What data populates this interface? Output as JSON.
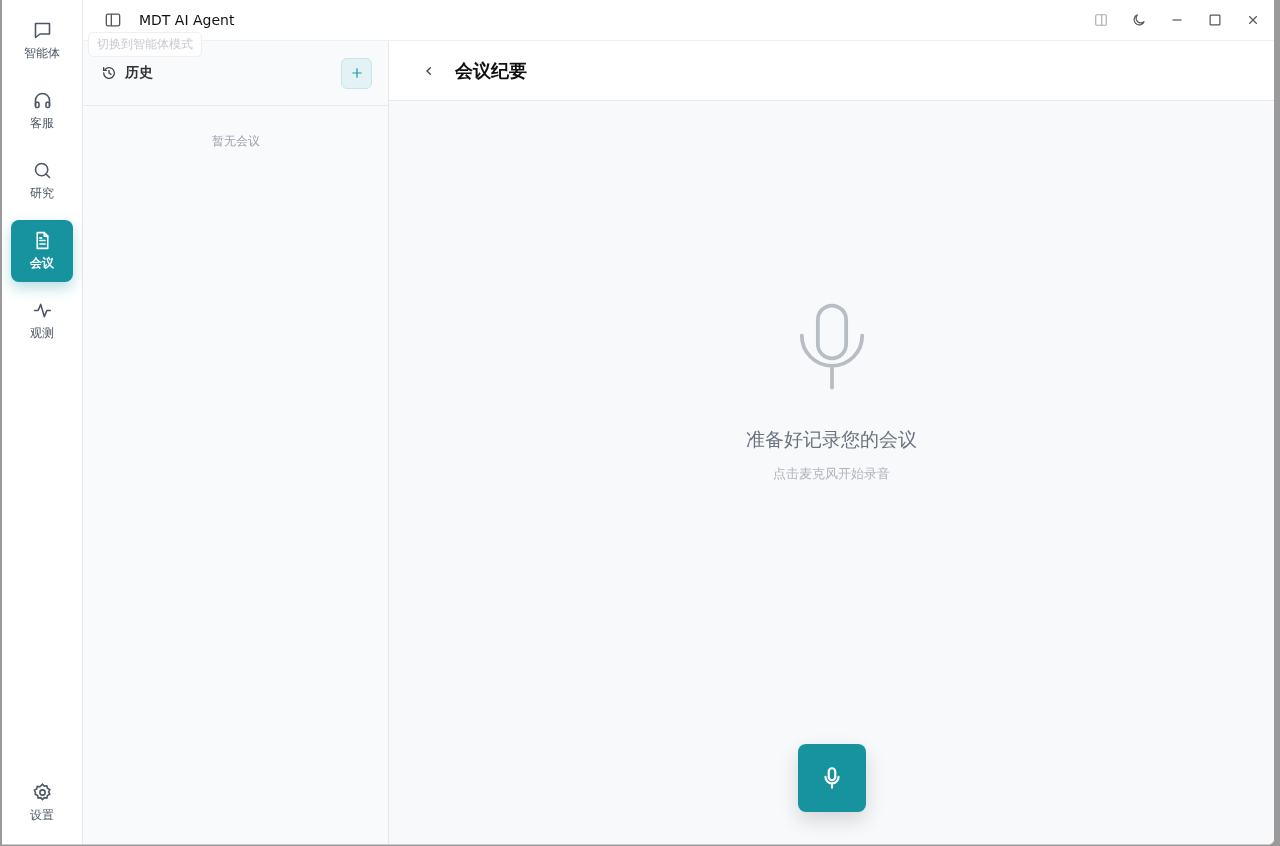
{
  "window": {
    "title": "MDT AI Agent"
  },
  "nav": [
    {
      "kind": "chat",
      "label": "智能体",
      "selected": false
    },
    {
      "kind": "headset",
      "label": "客服",
      "selected": false
    },
    {
      "kind": "search",
      "label": "研究",
      "selected": false
    },
    {
      "kind": "document",
      "label": "会议",
      "selected": true
    },
    {
      "kind": "pulse",
      "label": "观测",
      "selected": false
    }
  ],
  "settings": {
    "label": "设置"
  },
  "tooltip": "切换到智能体模式",
  "history": {
    "title": "历史",
    "empty": "暂无会议"
  },
  "main": {
    "title": "会议纪要",
    "heading": "准备好记录您的会议",
    "hint": "点击麦克风开始录音"
  }
}
